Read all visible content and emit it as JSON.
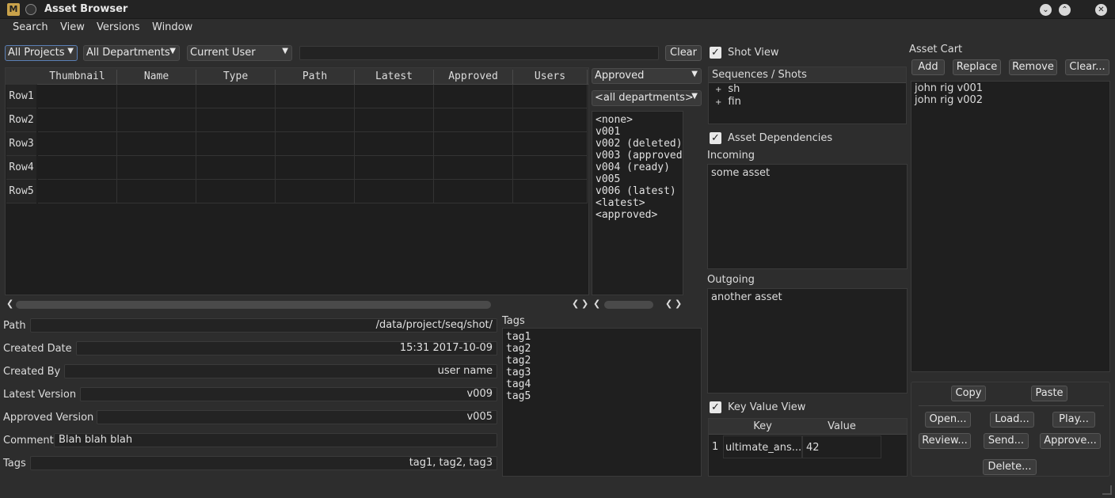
{
  "window": {
    "title": "Asset Browser"
  },
  "menu": [
    "Search",
    "View",
    "Versions",
    "Window"
  ],
  "filters": {
    "project": "All Projects",
    "department": "All Departments",
    "user": "Current User",
    "clear_label": "Clear"
  },
  "grid": {
    "columns": [
      "Thumbnail",
      "Name",
      "Type",
      "Path",
      "Latest",
      "Approved",
      "Users"
    ],
    "rows": [
      "Row1",
      "Row2",
      "Row3",
      "Row4",
      "Row5"
    ]
  },
  "versions": {
    "status_combo": "Approved",
    "dept_combo": "<all departments>",
    "items": [
      "<none>",
      "v001",
      "v002 (deleted)",
      "v003 (approved",
      "v004 (ready)",
      "v005",
      "v006 (latest)",
      "<latest>",
      "<approved>"
    ]
  },
  "info": {
    "path_label": "Path",
    "path": "/data/project/seq/shot/",
    "created_date_label": "Created Date",
    "created_date": "15:31 2017-10-09",
    "created_by_label": "Created By",
    "created_by": "user name",
    "latest_label": "Latest Version",
    "latest": "v009",
    "approved_label": "Approved Version",
    "approved": "v005",
    "comment_label": "Comment",
    "comment": "Blah blah blah",
    "tags_label": "Tags",
    "tags": "tag1, tag2, tag3"
  },
  "tags_panel": {
    "label": "Tags",
    "items": [
      "tag1",
      "tag2",
      "tag2",
      "tag3",
      "tag4",
      "tag5"
    ]
  },
  "shot_view": {
    "label": "Shot View",
    "header": "Sequences / Shots",
    "items": [
      "sh",
      "fin"
    ]
  },
  "deps": {
    "label": "Asset Dependencies",
    "incoming_label": "Incoming",
    "incoming": "some asset",
    "outgoing_label": "Outgoing",
    "outgoing": "another asset"
  },
  "kv": {
    "label": "Key Value View",
    "key_header": "Key",
    "value_header": "Value",
    "row_num": "1",
    "key": "ultimate_ans...",
    "value": "42"
  },
  "cart": {
    "label": "Asset Cart",
    "add": "Add",
    "replace": "Replace",
    "remove": "Remove",
    "clear": "Clear...",
    "items": [
      "john rig v001",
      "john rig v002"
    ],
    "copy": "Copy",
    "paste": "Paste",
    "open": "Open...",
    "load": "Load...",
    "play": "Play...",
    "review": "Review...",
    "send": "Send...",
    "approve": "Approve...",
    "delete": "Delete..."
  }
}
